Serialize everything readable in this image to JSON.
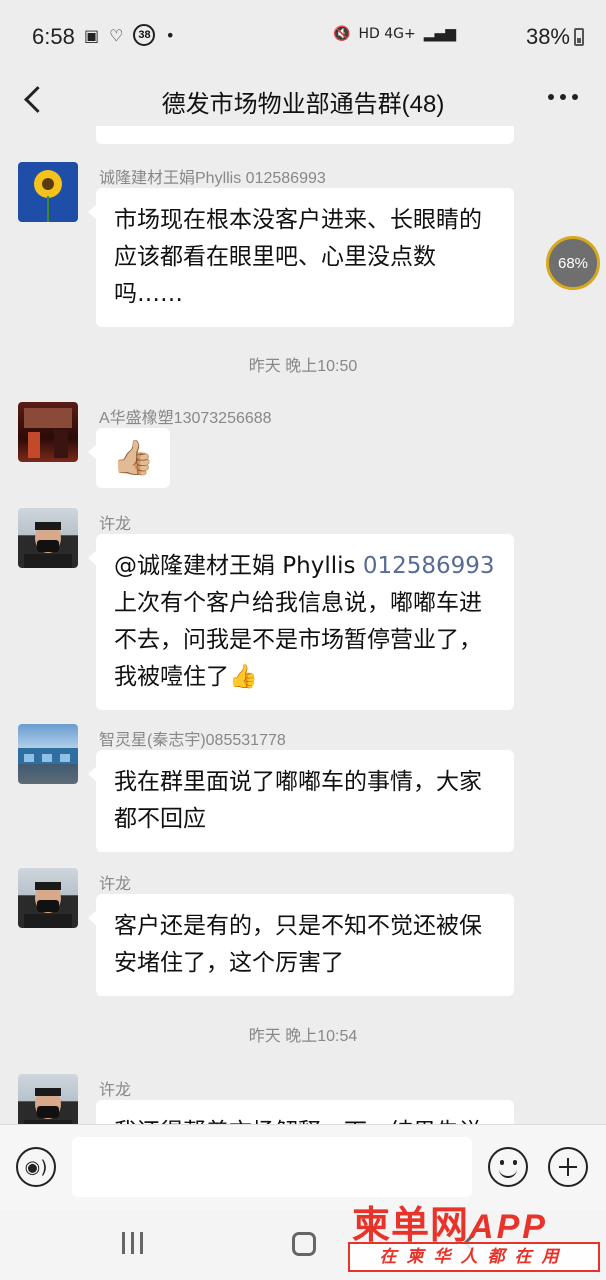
{
  "status_bar": {
    "time": "6:58",
    "notification_badge": "38",
    "dot": "•",
    "network": "HD 4G+",
    "battery": "38%"
  },
  "header": {
    "title": "德发市场物业部通告群(48)"
  },
  "floating_progress": "68%",
  "messages": [
    {
      "sender": "诚隆建材王娟Phyllis 012586993",
      "text": "市场现在根本没客户进来、长眼睛的应该都看在眼里吧、心里没点数吗……"
    },
    {
      "timestamp": "昨天 晚上10:50"
    },
    {
      "sender": "A华盛橡塑13073256688",
      "emoji": "👍🏼"
    },
    {
      "sender": "许龙",
      "mention_name": "@诚隆建材王娟 Phyllis ",
      "mention_number": "012586993",
      "text": "上次有个客户给我信息说，嘟嘟车进不去，问我是不是市场暂停营业了，我被噎住了👍"
    },
    {
      "sender": "智灵星(秦志宇)085531778",
      "text": "我在群里面说了嘟嘟车的事情，大家都不回应"
    },
    {
      "sender": "许龙",
      "text": "客户还是有的，只是不知不觉还被保安堵住了，这个厉害了"
    },
    {
      "timestamp": "昨天 晚上10:54"
    },
    {
      "sender": "许龙",
      "text": "我还得帮着市场解释一下，结果先说"
    }
  ],
  "input_bar": {
    "placeholder": ""
  },
  "watermark": {
    "brand": "柬单网",
    "app": "APP",
    "slogan": "在柬华人都在用"
  },
  "icons": {
    "back": "back-arrow-icon",
    "more": "more-dots-icon",
    "voice": "voice-icon",
    "emoji": "emoji-icon",
    "plus": "plus-icon"
  },
  "colors": {
    "background": "#ededed",
    "bubble": "#ffffff",
    "mention_link": "#576b95",
    "watermark_red": "#e8332b"
  }
}
